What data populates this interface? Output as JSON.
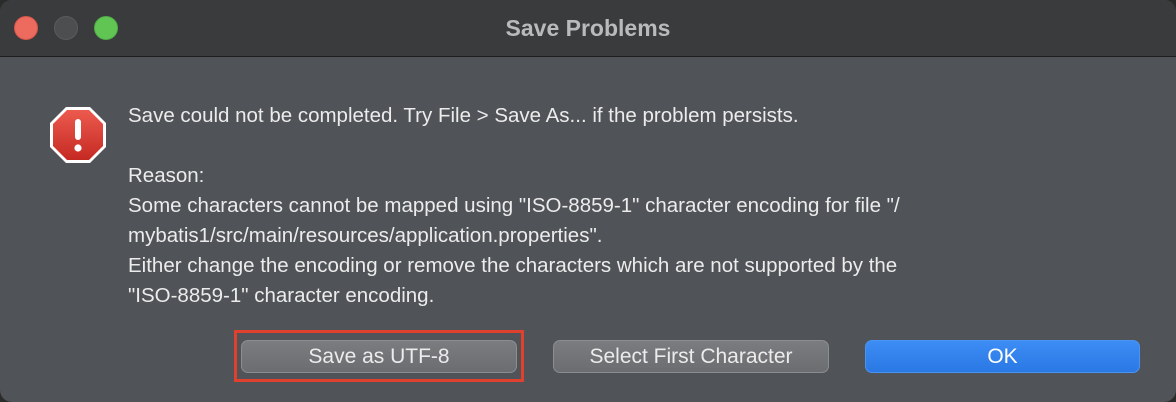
{
  "window": {
    "title": "Save Problems"
  },
  "alert": {
    "icon": "alert-octagon-icon",
    "headline": "Save could not be completed. Try File > Save As... if the problem persists.",
    "reason_label": "Reason:",
    "reason_lines": [
      "Some characters cannot be mapped using \"ISO-8859-1\" character encoding for file \"/",
      "mybatis1/src/main/resources/application.properties\".",
      "Either change the encoding or remove the characters which are not supported by the",
      "\"ISO-8859-1\" character encoding."
    ]
  },
  "buttons": {
    "save_utf8": "Save as UTF-8",
    "select_first": "Select First Character",
    "ok": "OK"
  },
  "colors": {
    "dialog_bg": "#505357",
    "titlebar_bg": "#3a3b3d",
    "primary_button": "#2a78e4",
    "highlight_box": "#e0402e",
    "alert_red": "#d9382e"
  }
}
